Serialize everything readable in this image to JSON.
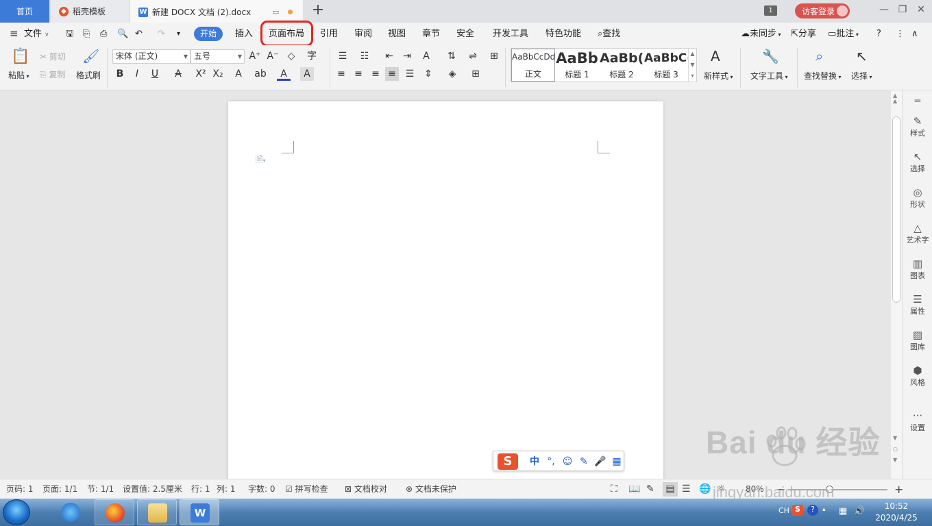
{
  "tabs": {
    "home": "首页",
    "templates": "稻壳模板",
    "doc": "新建 DOCX 文档 (2).docx",
    "window_count": "1",
    "login": "访客登录"
  },
  "menu": {
    "file": "文件",
    "ribbon_tabs": [
      "开始",
      "插入",
      "页面布局",
      "引用",
      "审阅",
      "视图",
      "章节",
      "安全",
      "开发工具",
      "特色功能"
    ],
    "search": "查找",
    "right": {
      "sync": "未同步",
      "share": "分享",
      "comment": "批注"
    }
  },
  "ribbon": {
    "paste": "粘贴",
    "cut": "剪切",
    "copy": "复制",
    "format_painter": "格式刷",
    "font_name": "宋体 (正文)",
    "font_size": "五号",
    "styles": [
      {
        "preview": "AaBbCcDd",
        "name": "正文"
      },
      {
        "preview": "AaBb",
        "name": "标题 1"
      },
      {
        "preview": "AaBb(",
        "name": "标题 2"
      },
      {
        "preview": "AaBbC(",
        "name": "标题 3"
      }
    ],
    "new_style": "新样式",
    "text_tools": "文字工具",
    "find_replace": "查找替换",
    "select": "选择"
  },
  "sidebar": [
    "样式",
    "选择",
    "形状",
    "艺术字",
    "图表",
    "属性",
    "图库",
    "风格",
    "设置"
  ],
  "ime": {
    "lang": "中",
    "punct": "°,"
  },
  "status": {
    "page_num": "页码: 1",
    "pages": "页面: 1/1",
    "section": "节: 1/1",
    "setting": "设置值: 2.5厘米",
    "row": "行: 1",
    "col": "列: 1",
    "words": "字数: 0",
    "spell": "拼写检查",
    "proof": "文档校对",
    "protect": "文档未保护",
    "zoom": "80%"
  },
  "taskbar": {
    "time": "10:52",
    "date": "2020/4/25",
    "lang": "CH"
  },
  "watermark": {
    "brand": "Bai du 经验",
    "url": "jingyan.baidu.com"
  },
  "colors": {
    "accent": "#3d7bd9",
    "highlight": "#e3261e",
    "login": "#d9534f"
  }
}
